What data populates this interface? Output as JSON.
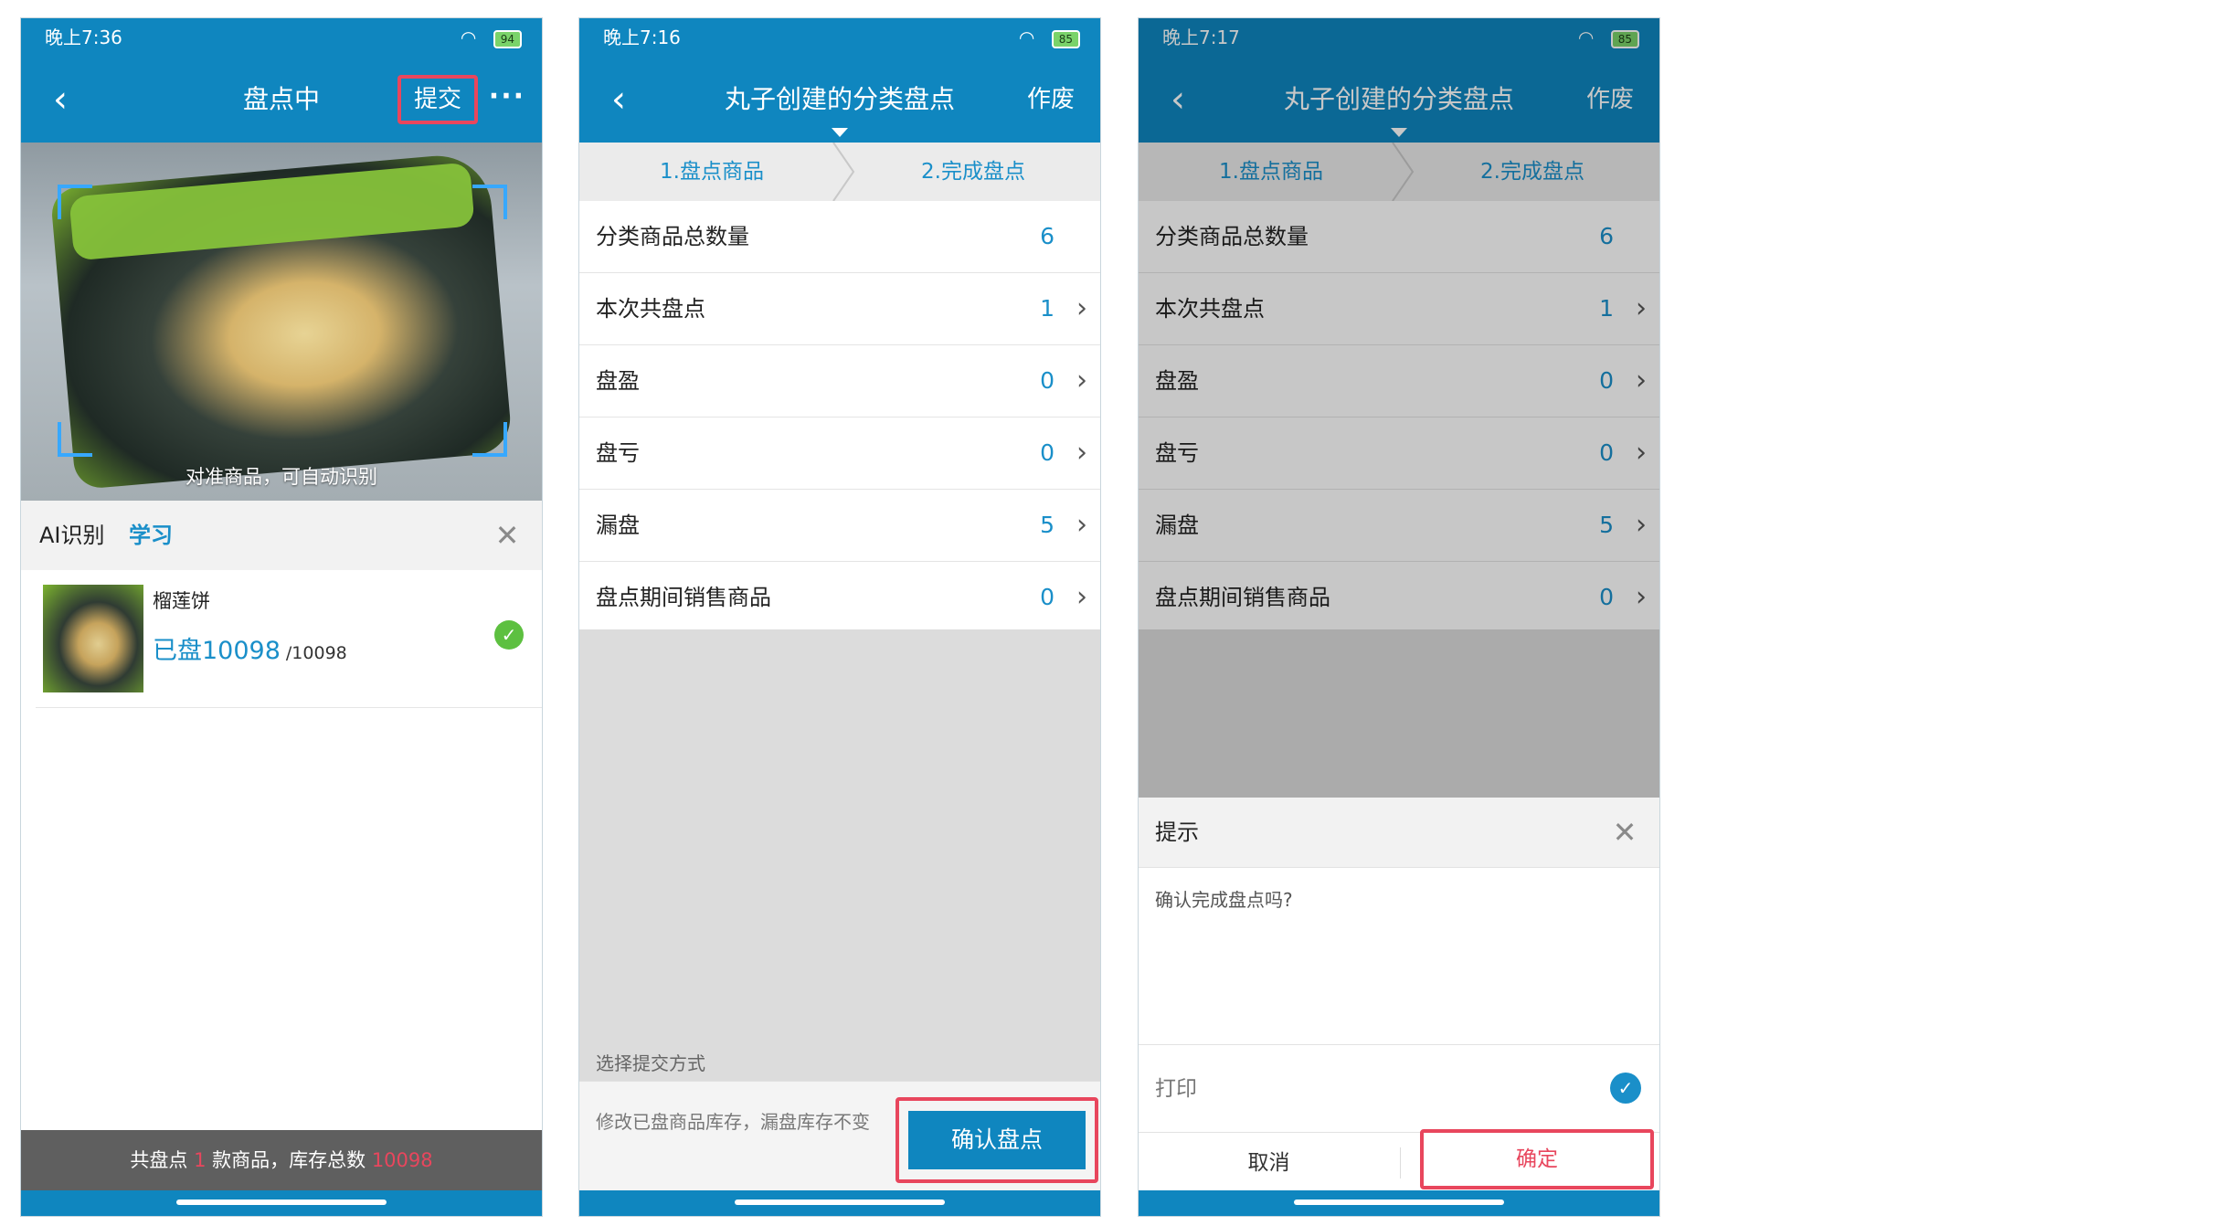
{
  "phone1": {
    "status": {
      "time": "晚上7:36",
      "battery": "94"
    },
    "nav": {
      "back": "‹",
      "title": "盘点中",
      "submit": "提交",
      "more": "···"
    },
    "camera_hint": "对准商品，可自动识别",
    "ai": {
      "label": "AI识别",
      "learn": "学习",
      "close": "✕"
    },
    "item": {
      "name": "榴莲饼",
      "counted": "已盘10098",
      "total": "/10098",
      "check": "✓"
    },
    "footer": {
      "prefix": "共盘点",
      "count": "1",
      "middle": "款商品，库存总数",
      "total": "10098"
    }
  },
  "phone2": {
    "status": {
      "time": "晚上7:16",
      "battery": "85"
    },
    "nav": {
      "back": "‹",
      "title": "丸子创建的分类盘点",
      "right": "作废"
    },
    "steps": [
      "1.盘点商品",
      "2.完成盘点"
    ],
    "rows": [
      {
        "label": "分类商品总数量",
        "value": "6",
        "arrow": ""
      },
      {
        "label": "本次共盘点",
        "value": "1",
        "arrow": "›"
      },
      {
        "label": "盘盈",
        "value": "0",
        "arrow": "›"
      },
      {
        "label": "盘亏",
        "value": "0",
        "arrow": "›"
      },
      {
        "label": "漏盘",
        "value": "5",
        "arrow": "›"
      },
      {
        "label": "盘点期间销售商品",
        "value": "0",
        "arrow": "›"
      }
    ],
    "submit_hint": "选择提交方式",
    "submit_text": "修改已盘商品库存，漏盘库存不变",
    "confirm": "确认盘点"
  },
  "phone3": {
    "status": {
      "time": "晚上7:17",
      "battery": "85"
    },
    "nav": {
      "back": "‹",
      "title": "丸子创建的分类盘点",
      "right": "作废"
    },
    "steps": [
      "1.盘点商品",
      "2.完成盘点"
    ],
    "rows": [
      {
        "label": "分类商品总数量",
        "value": "6",
        "arrow": ""
      },
      {
        "label": "本次共盘点",
        "value": "1",
        "arrow": "›"
      },
      {
        "label": "盘盈",
        "value": "0",
        "arrow": "›"
      },
      {
        "label": "盘亏",
        "value": "0",
        "arrow": "›"
      },
      {
        "label": "漏盘",
        "value": "5",
        "arrow": "›"
      },
      {
        "label": "盘点期间销售商品",
        "value": "0",
        "arrow": "›"
      }
    ],
    "dialog": {
      "title": "提示",
      "close": "✕",
      "message": "确认完成盘点吗?",
      "print": "打印",
      "tick": "✓",
      "cancel": "取消",
      "ok": "确定"
    }
  },
  "colors": {
    "primary": "#0f86bf",
    "accent": "#1a8fc9",
    "highlight": "#e8465d",
    "success": "#5dc040"
  }
}
